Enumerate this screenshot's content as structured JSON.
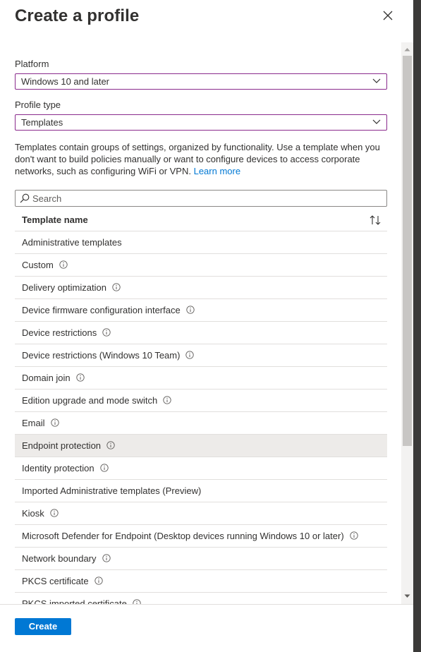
{
  "title": "Create a profile",
  "platform": {
    "label": "Platform",
    "value": "Windows 10 and later"
  },
  "profile_type": {
    "label": "Profile type",
    "value": "Templates"
  },
  "description": {
    "text": "Templates contain groups of settings, organized by functionality. Use a template when you don't want to build policies manually or want to configure devices to access corporate networks, such as configuring WiFi or VPN. ",
    "link": "Learn more"
  },
  "search": {
    "placeholder": "Search"
  },
  "table": {
    "header": "Template name",
    "rows": [
      {
        "label": "Administrative templates",
        "info": false
      },
      {
        "label": "Custom",
        "info": true
      },
      {
        "label": "Delivery optimization",
        "info": true
      },
      {
        "label": "Device firmware configuration interface",
        "info": true
      },
      {
        "label": "Device restrictions",
        "info": true
      },
      {
        "label": "Device restrictions (Windows 10 Team)",
        "info": true
      },
      {
        "label": "Domain join",
        "info": true
      },
      {
        "label": "Edition upgrade and mode switch",
        "info": true
      },
      {
        "label": "Email",
        "info": true
      },
      {
        "label": "Endpoint protection",
        "info": true,
        "selected": true
      },
      {
        "label": "Identity protection",
        "info": true
      },
      {
        "label": "Imported Administrative templates (Preview)",
        "info": false
      },
      {
        "label": "Kiosk",
        "info": true
      },
      {
        "label": "Microsoft Defender for Endpoint (Desktop devices running Windows 10 or later)",
        "info": true
      },
      {
        "label": "Network boundary",
        "info": true
      },
      {
        "label": "PKCS certificate",
        "info": true
      },
      {
        "label": "PKCS imported certificate",
        "info": true
      }
    ]
  },
  "footer": {
    "create_label": "Create"
  },
  "colors": {
    "accent": "#0078d4",
    "select_border": "#8a2a8c",
    "selected_row": "#edebe9"
  }
}
